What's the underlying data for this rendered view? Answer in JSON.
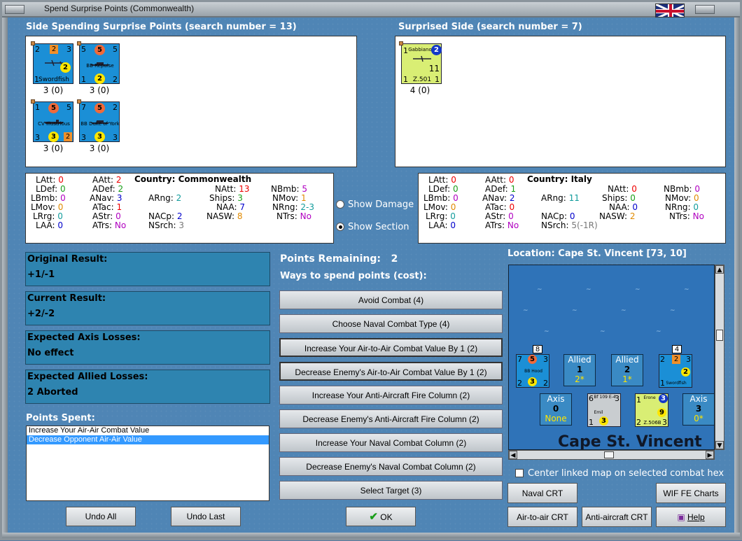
{
  "window": {
    "title": "Spend Surprise Points (Commonwealth)"
  },
  "spending": {
    "header": "Side Spending Surprise Points (search number = 13)",
    "units": [
      {
        "name": "Swordfish",
        "tl": "2",
        "tc": "2",
        "tr": "3",
        "circ": "2",
        "bl": "1",
        "caption": "3 (0)"
      },
      {
        "name": "BB Repulse",
        "tl": "5",
        "tc": "5",
        "tr": "5",
        "circ": "2",
        "bl": "1",
        "br": "2",
        "caption": "3 (0)"
      },
      {
        "name": "CV Illustrious",
        "tl": "1",
        "tc": "5",
        "tr": "5",
        "circ": "3",
        "bl": "3",
        "br": "2",
        "caption": "3 (0)"
      },
      {
        "name": "BB Duke of York",
        "tl": "7",
        "tc": "5",
        "tr": "2",
        "circ": "3",
        "bl": "3",
        "br": "3",
        "caption": "3 (0)"
      }
    ]
  },
  "surprised": {
    "header": "Surprised Side (search number = 7)",
    "units": [
      {
        "name": "Gabbiano",
        "sub": "Z.501",
        "tl": "1",
        "circ": "2",
        "big": "11",
        "bl": "1",
        "br": "1",
        "caption": "4 (0)"
      }
    ]
  },
  "stats_left": {
    "country": "Country: Commonwealth",
    "LAtt": "0",
    "AAtt": "2",
    "NAtt": "13",
    "NBmb": "5",
    "LDef": "0",
    "ADef": "2",
    "Ships": "3",
    "NMov": "1",
    "LBmb": "0",
    "ANav": "3",
    "ARng": "2",
    "NAA": "7",
    "NRng": "2-3",
    "LMov": "0",
    "ATac": "1",
    "NASW": "8",
    "NTrs": "No",
    "LRrg": "0",
    "AStr": "0",
    "NACp": "2",
    "LAA": "0",
    "ATrs": "No",
    "NSrch": "3"
  },
  "stats_right": {
    "country": "Country: Italy",
    "LAtt": "0",
    "AAtt": "0",
    "NAtt": "0",
    "NBmb": "0",
    "LDef": "0",
    "ADef": "1",
    "Ships": "0",
    "NMov": "0",
    "LBmb": "0",
    "ANav": "2",
    "ARng": "11",
    "NAA": "0",
    "NRng": "0",
    "LMov": "0",
    "ATac": "0",
    "NASW": "2",
    "NTrs": "No",
    "LRrg": "0",
    "AStr": "0",
    "NACp": "0",
    "LAA": "0",
    "ATrs": "No",
    "NSrch": "5(-1R)"
  },
  "view": {
    "show_damage": "Show Damage",
    "show_section": "Show Section"
  },
  "results": {
    "original_label": "Original Result:",
    "original_value": "+1/-1",
    "current_label": "Current Result:",
    "current_value": "+2/-2",
    "axis_label": "Expected Axis Losses:",
    "axis_value": "No effect",
    "allied_label": "Expected Allied Losses:",
    "allied_value": "2 Aborted"
  },
  "points": {
    "spent_label": "Points Spent:",
    "spent": [
      "Increase Your Air-Air Combat Value",
      "Decrease Opponent Air-Air Value"
    ],
    "remaining_label": "Points Remaining:",
    "remaining_value": "2",
    "ways_label": "Ways to spend points (cost):"
  },
  "options": [
    "Avoid Combat (4)",
    "Choose Naval Combat Type (4)",
    "Increase Your Air-to-Air Combat Value By 1 (2)",
    "Decrease Enemy's Air-to-Air Combat Value By 1 (2)",
    "Increase Your Anti-Aircraft Fire Column (2)",
    "Decrease Enemy's Anti-Aircraft Fire Column (2)",
    "Increase Your Naval Combat Column (2)",
    "Decrease Enemy's Naval Combat Column (2)",
    "Select Target (3)"
  ],
  "location": {
    "label": "Location: Cape St. Vincent [73, 10]",
    "map_name": "Cape St. Vincent",
    "allied1": {
      "title": "Allied",
      "num": "1",
      "sub": "2*"
    },
    "allied2": {
      "title": "Allied",
      "num": "2",
      "sub": "1*"
    },
    "axis0": {
      "title": "Axis",
      "num": "0",
      "sub": "None"
    },
    "axis3": {
      "title": "Axis",
      "num": "3",
      "sub": "0*"
    },
    "stack_left": "8",
    "stack_right": "4",
    "bbhood": {
      "name": "BB Hood",
      "tl": "7",
      "tc": "5",
      "tr": "3",
      "circ": "3",
      "bl": "2",
      "br": "2"
    },
    "swordfish": {
      "name": "Swordfish",
      "tl": "2",
      "tc": "2",
      "tr": "3",
      "circ": "2",
      "bl": "1"
    },
    "bf109": {
      "name": "Bf 109 E-4",
      "sub": "Emil",
      "tl": "6",
      "tr": "3",
      "circ": "3",
      "bl": "1"
    },
    "erone": {
      "name": "Erone",
      "sub": "Z.506B",
      "tl": "1",
      "circ": "3",
      "big": "9",
      "bl": "2",
      "br": "3"
    },
    "center_map": "Center linked map on selected combat hex"
  },
  "buttons": {
    "undo_all": "Undo All",
    "undo_last": "Undo Last",
    "ok": "OK",
    "naval_crt": "Naval CRT",
    "wif_charts": "WIF FE Charts",
    "air_crt": "Air-to-air CRT",
    "aa_crt": "Anti-aircraft CRT",
    "help": "Help"
  },
  "colors": {
    "accent": "#4f85b5",
    "result_box": "#2e84b0",
    "selection": "#3399ff"
  }
}
